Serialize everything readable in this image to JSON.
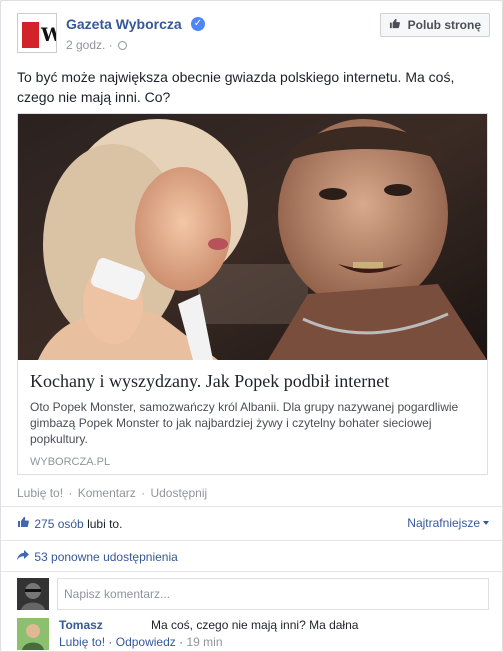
{
  "post": {
    "page_name": "Gazeta Wyborcza",
    "logo_letter": "W",
    "time": "2 godz.",
    "like_page_label": "Polub stronę",
    "text": "To być może największa obecnie gwiazda polskiego internetu. Ma coś, czego nie mają inni. Co?"
  },
  "link": {
    "title": "Kochany i wyszydzany. Jak Popek podbił internet",
    "description": "Oto Popek Monster, samozwańczy król Albanii. Dla grupy nazywanej pogardliwie gimbazą Popek Monster to jak najbardziej żywy i czytelny bohater sieciowej popkultury.",
    "domain": "WYBORCZA.PL"
  },
  "actions": {
    "like": "Lubię to!",
    "comment": "Komentarz",
    "share": "Udostępnij"
  },
  "stats": {
    "likes_count": "275 osób",
    "likes_suffix": "lubi to.",
    "sort_label": "Najtrafniejsze",
    "shares": "53 ponowne udostępnienia"
  },
  "comment_box": {
    "placeholder": "Napisz komentarz..."
  },
  "comments": [
    {
      "author": "Tomasz",
      "text": "Ma coś, czego nie mają inni? Ma dałna",
      "like": "Lubię to!",
      "reply": "Odpowiedz",
      "time": "19 min"
    }
  ],
  "colors": {
    "link_blue": "#365899",
    "meta_gray": "#90949c",
    "brand_red": "#d2232a"
  }
}
